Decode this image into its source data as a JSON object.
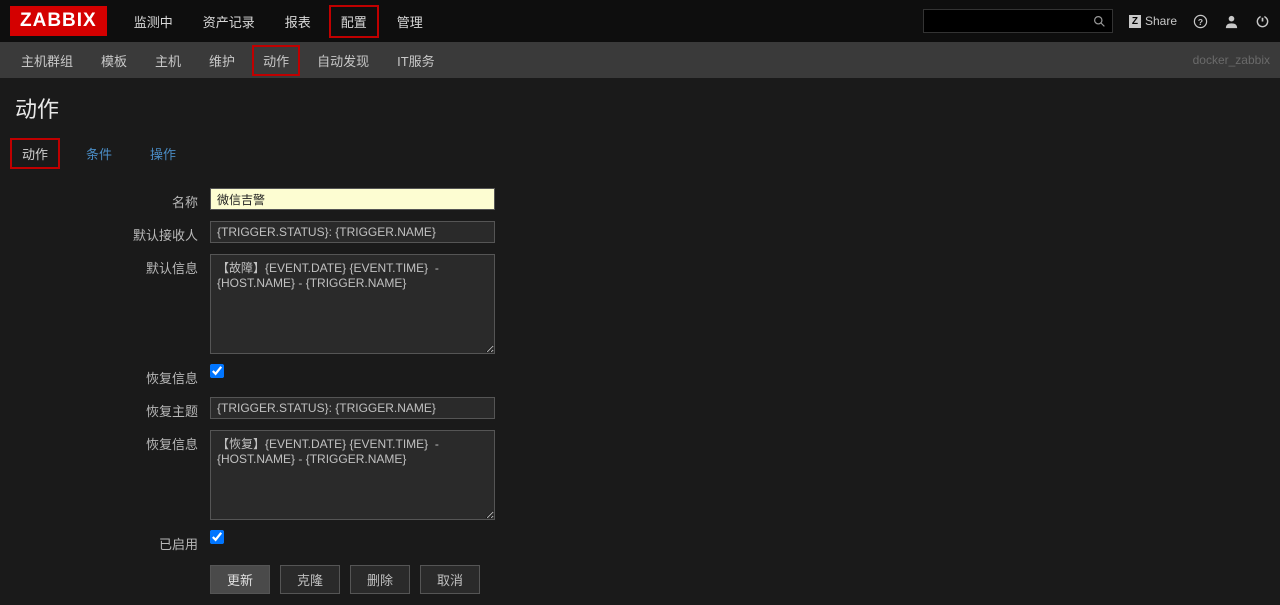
{
  "logo": "ZABBIX",
  "mainNav": {
    "items": [
      "监测中",
      "资产记录",
      "报表",
      "配置",
      "管理"
    ],
    "highlighted_index": 3
  },
  "navRight": {
    "share": "Share"
  },
  "subNav": {
    "items": [
      "主机群组",
      "模板",
      "主机",
      "维护",
      "动作",
      "自动发现",
      "IT服务"
    ],
    "active_index": 4,
    "highlighted_index": 4,
    "rightText": "docker_zabbix"
  },
  "pageTitle": "动作",
  "tabs": {
    "items": [
      "动作",
      "条件",
      "操作"
    ],
    "active_index": 0,
    "highlighted_index": 0
  },
  "form": {
    "labels": {
      "name": "名称",
      "defaultRecipient": "默认接收人",
      "defaultInfo": "默认信息",
      "recoveryInfo": "恢复信息",
      "recoveryTopic": "恢复主题",
      "recoveryInfoText": "恢复信息",
      "enabled": "已启用"
    },
    "values": {
      "name": "微信吉警",
      "defaultRecipient": "{TRIGGER.STATUS}: {TRIGGER.NAME}",
      "defaultInfo": "【故障】{EVENT.DATE} {EVENT.TIME}  -  {HOST.NAME} - {TRIGGER.NAME}",
      "recoveryTopic": "{TRIGGER.STATUS}: {TRIGGER.NAME}",
      "recoveryInfoText": "【恢复】{EVENT.DATE} {EVENT.TIME}  -  {HOST.NAME} - {TRIGGER.NAME}"
    }
  },
  "buttons": {
    "update": "更新",
    "clone": "克隆",
    "delete": "删除",
    "cancel": "取消"
  }
}
